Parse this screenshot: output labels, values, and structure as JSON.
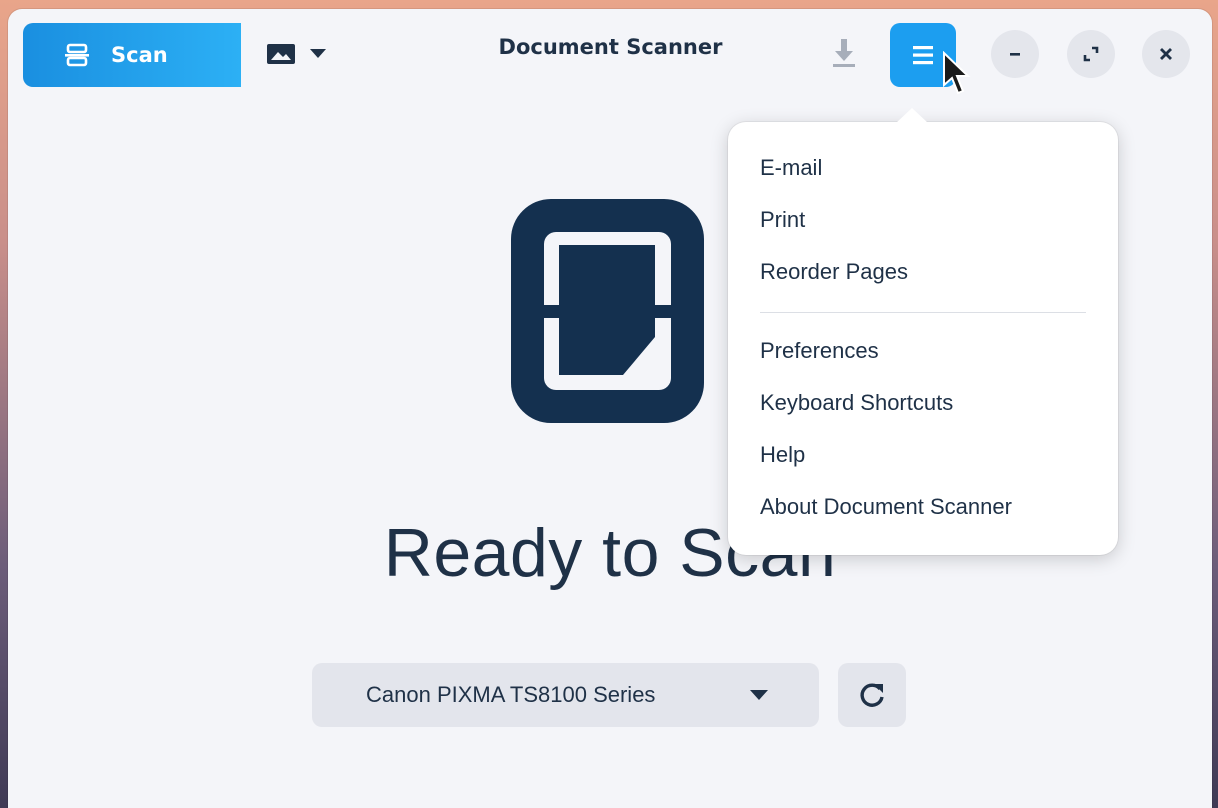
{
  "window": {
    "title": "Document Scanner"
  },
  "toolbar": {
    "scan_label": "Scan",
    "scan_icon": "scanner-icon",
    "type_icon": "image-icon",
    "download_icon": "download-icon",
    "menu_icon": "hamburger-menu-icon"
  },
  "window_controls": [
    "minimize",
    "maximize",
    "close"
  ],
  "main": {
    "status_text": "Ready to Scan",
    "scanner_device": "Canon PIXMA TS8100 Series",
    "refresh_icon": "refresh-icon"
  },
  "menu": {
    "group1": [
      "E-mail",
      "Print",
      "Reorder Pages"
    ],
    "group2": [
      "Preferences",
      "Keyboard Shortcuts",
      "Help",
      "About Document Scanner"
    ]
  },
  "colors": {
    "accent": "#1c9ef0",
    "text": "#1f3147",
    "window_bg": "#f4f5f9"
  }
}
